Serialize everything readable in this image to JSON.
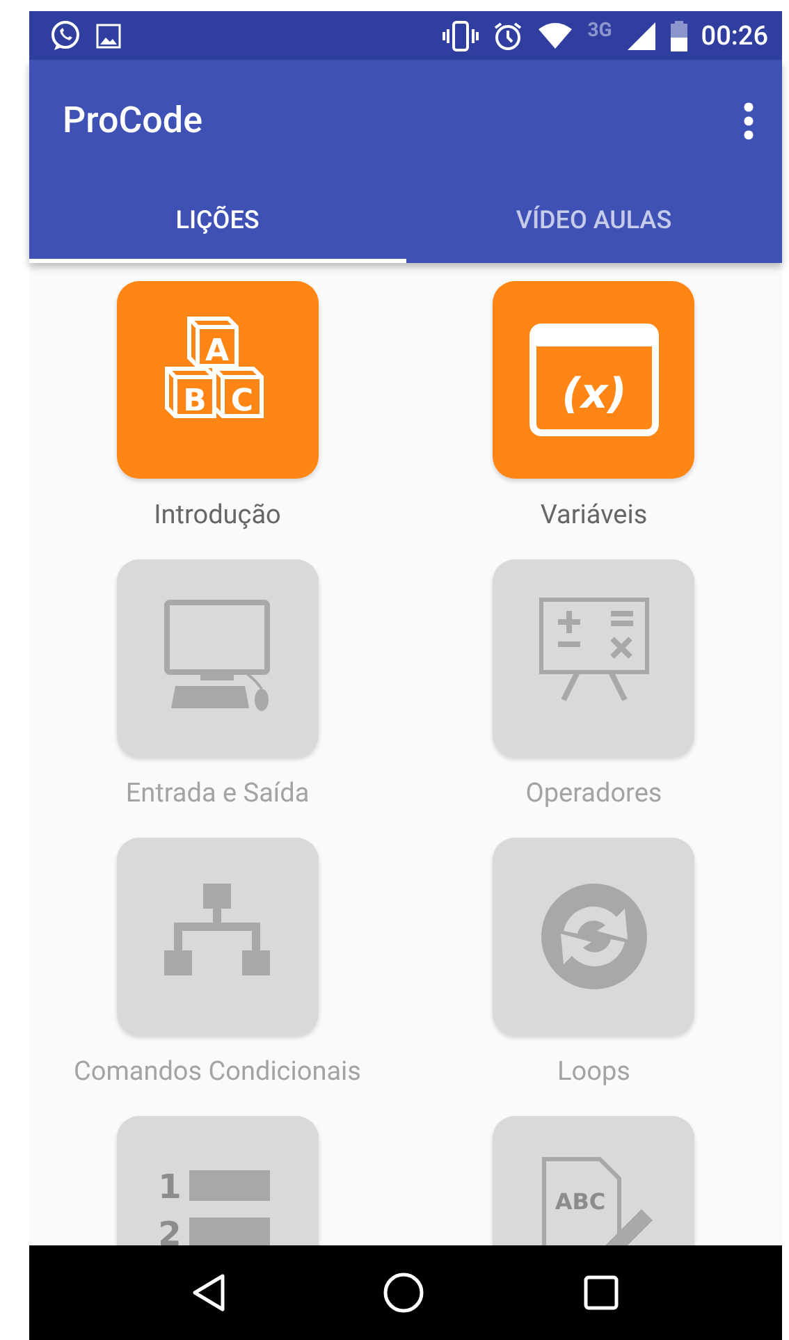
{
  "status_bar": {
    "network": "3G",
    "time": "00:26"
  },
  "app_bar": {
    "title": "ProCode"
  },
  "tabs": [
    {
      "label": "LIÇÕES",
      "selected": true
    },
    {
      "label": "VÍDEO AULAS",
      "selected": false
    }
  ],
  "lessons": [
    {
      "kind": "blocks",
      "glyphs": [
        "A",
        "B",
        "C"
      ],
      "label": "Introdução",
      "locked": false
    },
    {
      "kind": "variable",
      "glyphs": [
        "(x)"
      ],
      "label": "Variáveis",
      "locked": false
    },
    {
      "kind": "computer",
      "label": "Entrada e Saída",
      "locked": true
    },
    {
      "kind": "board",
      "label": "Operadores",
      "locked": true
    },
    {
      "kind": "flowchart",
      "label": "Comandos Condicionais",
      "locked": true
    },
    {
      "kind": "loop",
      "label": "Loops",
      "locked": true
    },
    {
      "kind": "list",
      "glyphs": [
        "1",
        "2"
      ],
      "locked": true
    },
    {
      "kind": "document",
      "glyphs": [
        "ABC"
      ],
      "locked": true
    }
  ]
}
